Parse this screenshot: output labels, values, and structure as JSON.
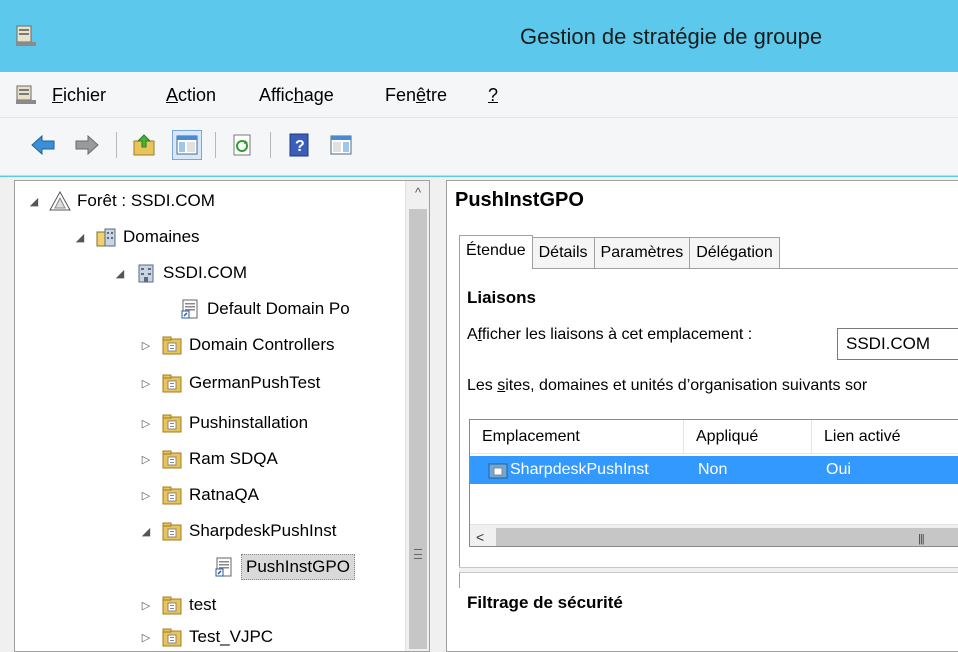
{
  "window": {
    "title": "Gestion de stratégie de groupe"
  },
  "menu": {
    "items": [
      {
        "pre": "",
        "ul": "F",
        "post": "ichier"
      },
      {
        "pre": "",
        "ul": "A",
        "post": "ction"
      },
      {
        "pre": "Affic",
        "ul": "h",
        "post": "age"
      },
      {
        "pre": "Fen",
        "ul": "ê",
        "post": "tre"
      },
      {
        "pre": "",
        "ul": "?",
        "post": ""
      }
    ]
  },
  "toolbar": {
    "icons": [
      "back-arrow-icon",
      "forward-arrow-icon",
      "up-folder-icon",
      "show-hide-tree-icon",
      "refresh-icon",
      "help-icon",
      "console-pane-icon"
    ]
  },
  "tree": {
    "items": [
      {
        "label": "Forêt : SSDI.COM",
        "expander": "◢",
        "icon": "forest-icon"
      },
      {
        "label": "Domaines",
        "expander": "◢",
        "icon": "domains-icon"
      },
      {
        "label": "SSDI.COM",
        "expander": "◢",
        "icon": "domain-icon"
      },
      {
        "label": "Default Domain Po",
        "expander": "",
        "icon": "gpo-link-icon"
      },
      {
        "label": "Domain Controllers",
        "expander": "▷",
        "icon": "ou-folder-icon"
      },
      {
        "label": "GermanPushTest",
        "expander": "▷",
        "icon": "ou-folder-icon"
      },
      {
        "label": "Pushinstallation",
        "expander": "▷",
        "icon": "ou-folder-icon"
      },
      {
        "label": "Ram SDQA",
        "expander": "▷",
        "icon": "ou-folder-icon"
      },
      {
        "label": "RatnaQA",
        "expander": "▷",
        "icon": "ou-folder-icon"
      },
      {
        "label": "SharpdeskPushInst",
        "expander": "◢",
        "icon": "ou-folder-icon"
      },
      {
        "label": "PushInstGPO",
        "expander": "",
        "icon": "gpo-link-icon"
      },
      {
        "label": "test",
        "expander": "▷",
        "icon": "ou-folder-icon"
      },
      {
        "label": "Test_VJPC",
        "expander": "▷",
        "icon": "ou-folder-icon"
      }
    ]
  },
  "detail": {
    "title": "PushInstGPO",
    "tabs": [
      "Étendue",
      "Détails",
      "Paramètres",
      "Délégation"
    ],
    "links_heading": "Liaisons",
    "show_links_label_pre": "A",
    "show_links_label_ul": "f",
    "show_links_label_post": "ficher les liaisons à cet emplacement :",
    "location_value": "SSDI.COM",
    "sites_text_pre": "Les ",
    "sites_text_ul": "s",
    "sites_text_post": "ites, domaines et unités d’organisation suivants sor",
    "columns": [
      "Emplacement",
      "Appliqué",
      "Lien activé"
    ],
    "rows": [
      {
        "location": "SharpdeskPushInst",
        "enforced": "Non",
        "enabled": "Oui"
      }
    ],
    "security_heading": "Filtrage de sécurité"
  },
  "colors": {
    "titlebar": "#5cc9ec",
    "selection": "#3399ff",
    "folder": "#e8c45a"
  }
}
